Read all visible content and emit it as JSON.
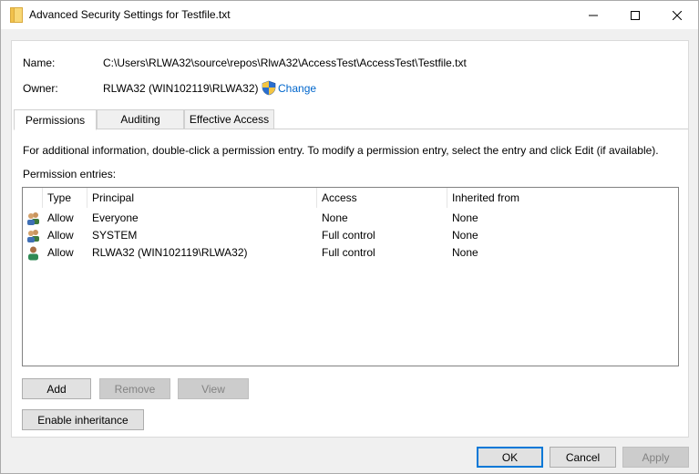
{
  "window": {
    "title": "Advanced Security Settings for Testfile.txt"
  },
  "info": {
    "name_label": "Name:",
    "name_value": "C:\\Users\\RLWA32\\source\\repos\\RlwA32\\AccessTest\\AccessTest\\Testfile.txt",
    "owner_label": "Owner:",
    "owner_value": "RLWA32 (WIN102119\\RLWA32)",
    "change_link": "Change"
  },
  "tabs": [
    {
      "label": "Permissions",
      "active": true
    },
    {
      "label": "Auditing",
      "active": false
    },
    {
      "label": "Effective Access",
      "active": false
    }
  ],
  "instructions": "For additional information, double-click a permission entry. To modify a permission entry, select the entry and click Edit (if available).",
  "entries_label": "Permission entries:",
  "table": {
    "columns": [
      "Type",
      "Principal",
      "Access",
      "Inherited from"
    ],
    "rows": [
      {
        "type": "Allow",
        "principal": "Everyone",
        "access": "None",
        "inherited": "None",
        "icon": "group-users-icon"
      },
      {
        "type": "Allow",
        "principal": "SYSTEM",
        "access": "Full control",
        "inherited": "None",
        "icon": "group-users-icon"
      },
      {
        "type": "Allow",
        "principal": "RLWA32 (WIN102119\\RLWA32)",
        "access": "Full control",
        "inherited": "None",
        "icon": "user-icon"
      }
    ]
  },
  "buttons": {
    "add": "Add",
    "remove": "Remove",
    "view": "View",
    "enable_inheritance": "Enable inheritance",
    "ok": "OK",
    "cancel": "Cancel",
    "apply": "Apply"
  },
  "colors": {
    "link": "#0066cc",
    "accent": "#0078d7",
    "folder": "#f8d775"
  }
}
